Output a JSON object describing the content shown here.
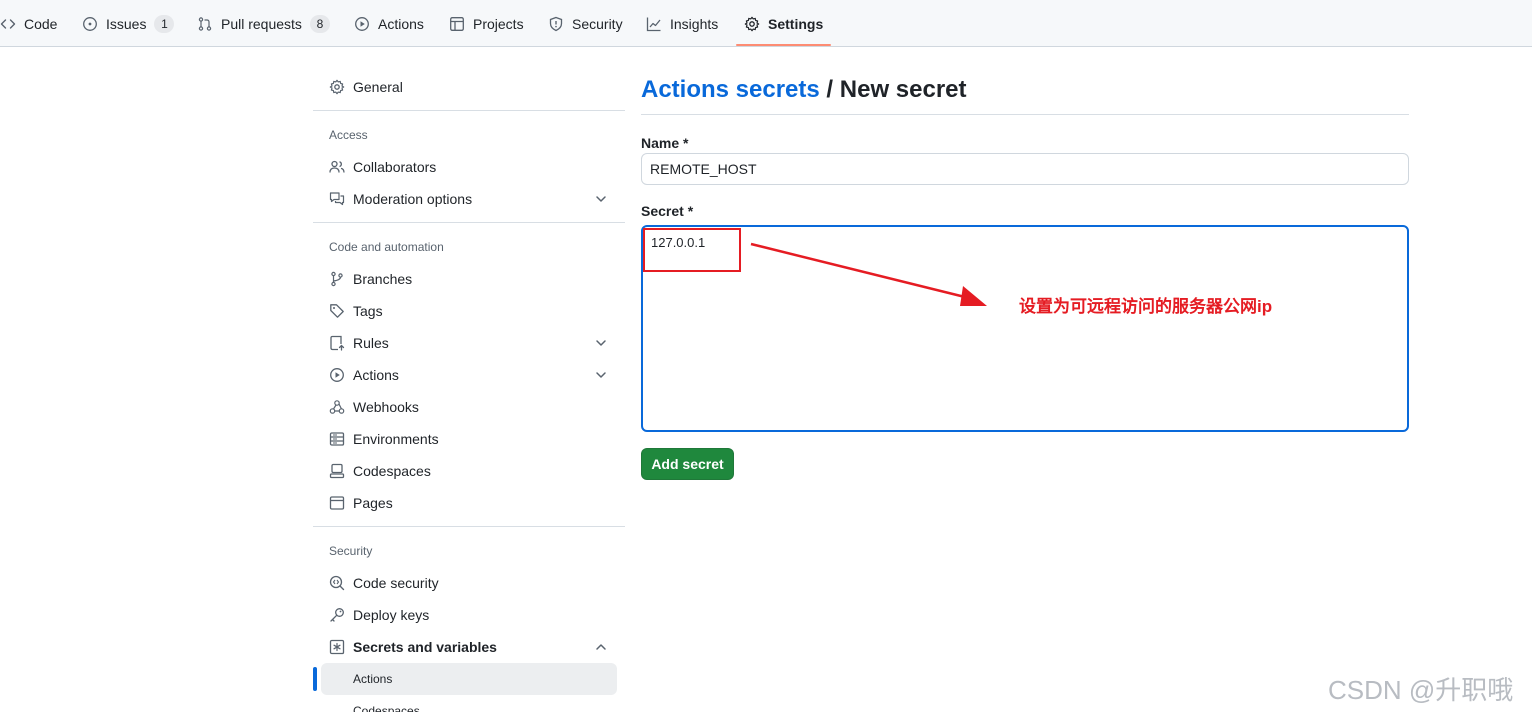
{
  "topnav": {
    "code": "Code",
    "issues": "Issues",
    "issues_count": "1",
    "pull_requests": "Pull requests",
    "pull_requests_count": "8",
    "actions": "Actions",
    "projects": "Projects",
    "security": "Security",
    "insights": "Insights",
    "settings": "Settings"
  },
  "sidebar": {
    "general": "General",
    "access_heading": "Access",
    "collaborators": "Collaborators",
    "moderation_options": "Moderation options",
    "code_automation_heading": "Code and automation",
    "branches": "Branches",
    "tags": "Tags",
    "rules": "Rules",
    "actions": "Actions",
    "webhooks": "Webhooks",
    "environments": "Environments",
    "codespaces": "Codespaces",
    "pages": "Pages",
    "security_heading": "Security",
    "code_security": "Code security",
    "deploy_keys": "Deploy keys",
    "secrets_and_variables": "Secrets and variables",
    "sub_actions": "Actions",
    "sub_codespaces": "Codespaces"
  },
  "main": {
    "title_link": "Actions secrets",
    "title_separator": " / ",
    "title_rest": "New secret",
    "name_label": "Name *",
    "name_value": "REMOTE_HOST",
    "secret_label": "Secret *",
    "secret_value": "127.0.0.1",
    "annotation": "设置为可远程访问的服务器公网ip",
    "add_button": "Add secret"
  },
  "watermark": "CSDN @升职哦",
  "colors": {
    "accent": "#0969da",
    "primary_button": "#1f883d",
    "annotation_red": "#e51c23",
    "selected_tab_underline": "#fd8c73"
  }
}
